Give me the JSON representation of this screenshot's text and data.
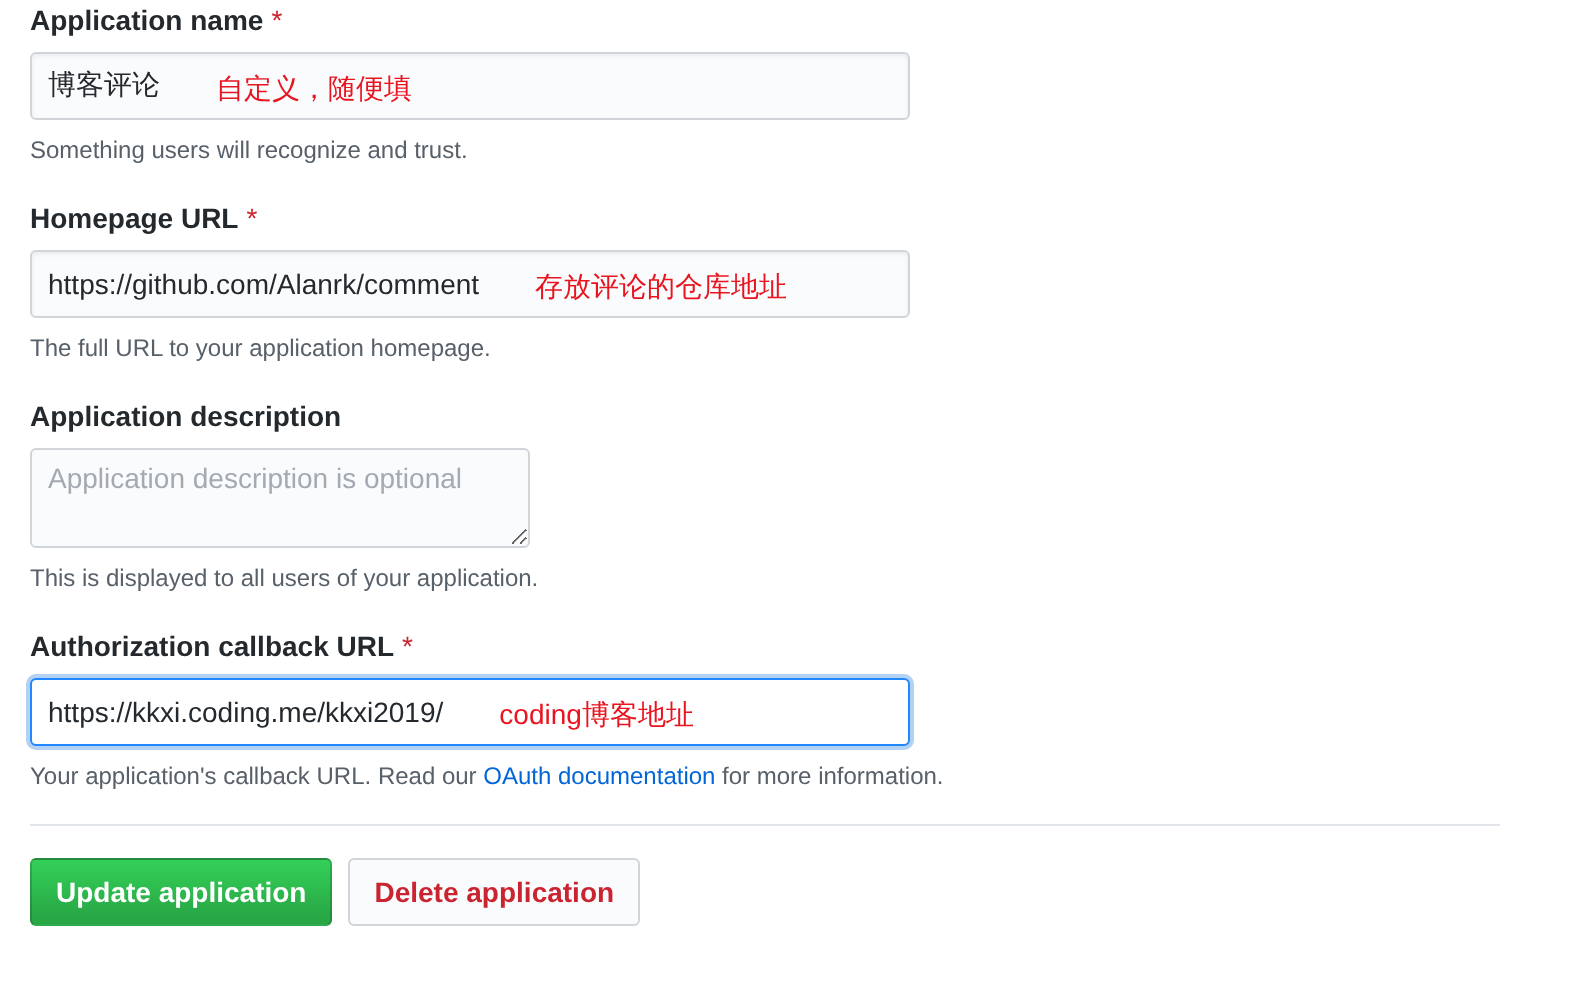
{
  "fields": [
    {
      "kind": "input",
      "label": "Application name",
      "required_mark": "*",
      "value": "博客评论",
      "annotation": "自定义，随便填",
      "focused": false,
      "hint": [
        {
          "kind": "text",
          "text": "Something users will recognize and trust."
        }
      ]
    },
    {
      "kind": "input",
      "label": "Homepage URL",
      "required_mark": "*",
      "value": "https://github.com/Alanrk/comment",
      "annotation": "存放评论的仓库地址",
      "focused": false,
      "hint": [
        {
          "kind": "text",
          "text": "The full URL to your application homepage."
        }
      ]
    },
    {
      "kind": "textarea",
      "label": "Application description",
      "placeholder": "Application description is optional",
      "focused": false,
      "hint": [
        {
          "kind": "text",
          "text": "This is displayed to all users of your application."
        }
      ]
    },
    {
      "kind": "input",
      "label": "Authorization callback URL",
      "required_mark": "*",
      "value": "https://kkxi.coding.me/kkxi2019/",
      "annotation": "coding博客地址",
      "focused": true,
      "hint": [
        {
          "kind": "text",
          "text": "Your application's callback URL. Read our "
        },
        {
          "kind": "link",
          "text": "OAuth documentation"
        },
        {
          "kind": "text",
          "text": " for more information."
        }
      ]
    }
  ],
  "buttons": [
    {
      "kind": "primary",
      "label": "Update application"
    },
    {
      "kind": "danger",
      "label": "Delete application"
    }
  ]
}
